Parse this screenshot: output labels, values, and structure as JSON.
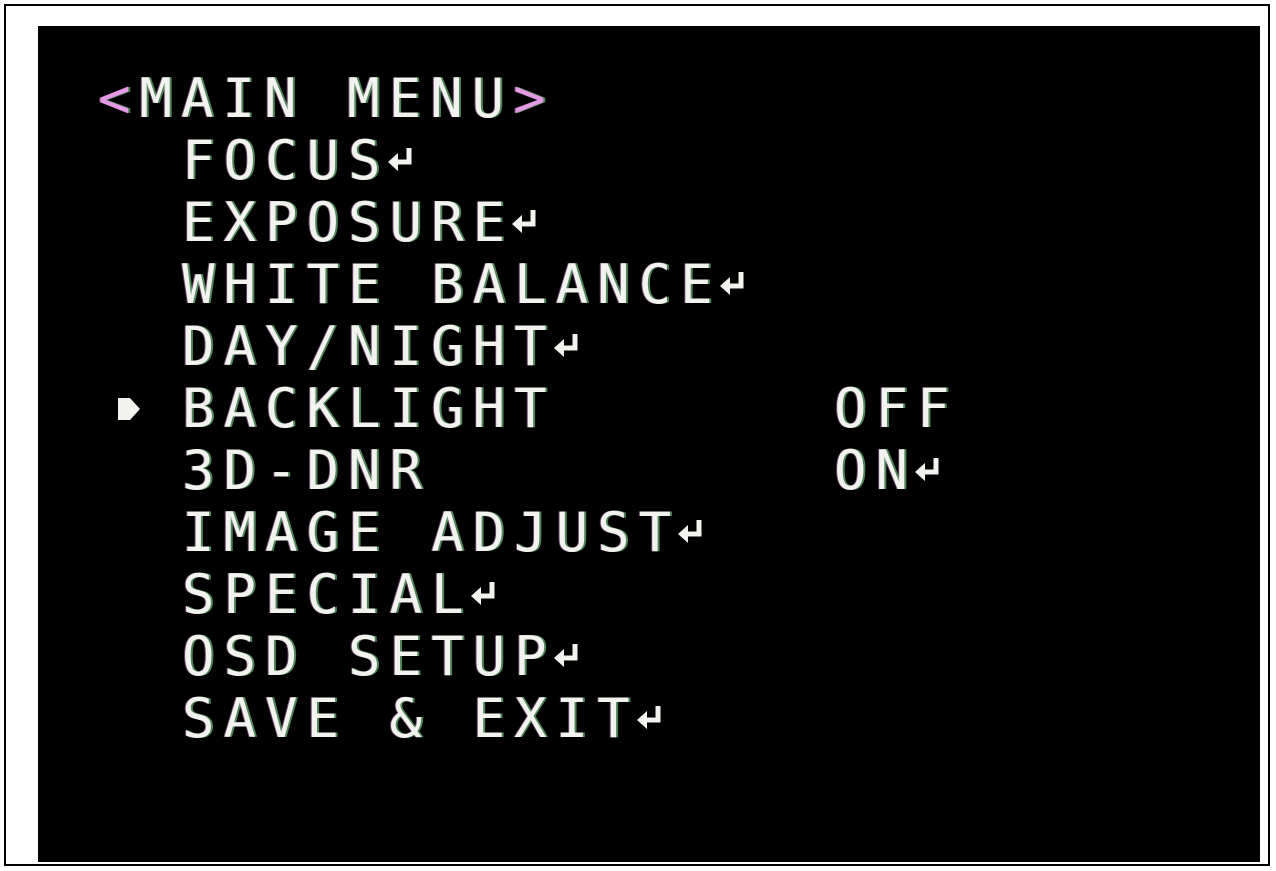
{
  "menu": {
    "title_open": "<",
    "title": "MAIN MENU",
    "title_close": ">",
    "items": [
      {
        "label": "FOCUS",
        "value": "",
        "submenu": true
      },
      {
        "label": "EXPOSURE",
        "value": "",
        "submenu": true
      },
      {
        "label": "WHITE BALANCE",
        "value": "",
        "submenu": true
      },
      {
        "label": "DAY/NIGHT",
        "value": "",
        "submenu": true
      },
      {
        "label": "BACKLIGHT",
        "value": "OFF",
        "submenu": false,
        "selected": true
      },
      {
        "label": "3D-DNR",
        "value": "ON",
        "submenu": true
      },
      {
        "label": "IMAGE ADJUST",
        "value": "",
        "submenu": true
      },
      {
        "label": "SPECIAL",
        "value": "",
        "submenu": true
      },
      {
        "label": "OSD SETUP",
        "value": "",
        "submenu": true
      },
      {
        "label": "SAVE & EXIT",
        "value": "",
        "submenu": true
      }
    ]
  },
  "icons": {
    "submenu": "enter-arrow-icon",
    "selection": "cursor-triangle-icon"
  },
  "colors": {
    "background": "#000000",
    "text": "#f2f2ee",
    "fringe_green": "#8cf0a0",
    "fringe_magenta": "#e696e6",
    "frame": "#000000",
    "page": "#ffffff"
  }
}
